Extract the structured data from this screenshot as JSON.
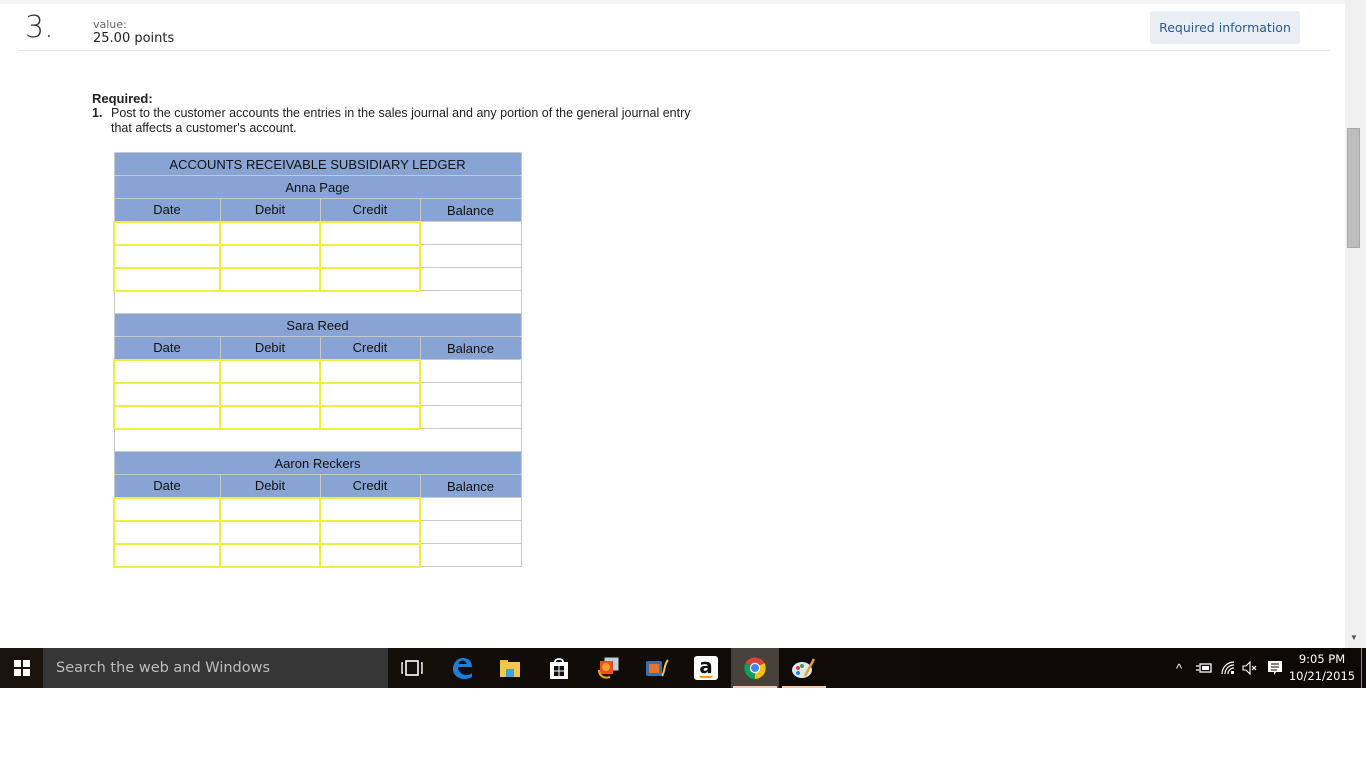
{
  "question": {
    "number": "3.",
    "value_label": "value:",
    "points": "25.00 points",
    "required_info_button": "Required information"
  },
  "instructions": {
    "title": "Required:",
    "items": [
      {
        "num": "1.",
        "text": "Post to the customer accounts the entries in the sales journal and any portion of the general journal entry that affects a customer's account."
      }
    ]
  },
  "ledger": {
    "title": "ACCOUNTS RECEIVABLE SUBSIDIARY LEDGER",
    "columns": [
      "Date",
      "Debit",
      "Credit",
      "Balance"
    ],
    "accounts": [
      {
        "name": "Anna Page",
        "rows": [
          [
            "",
            "",
            "",
            ""
          ],
          [
            "",
            "",
            "",
            ""
          ],
          [
            "",
            "",
            "",
            ""
          ]
        ]
      },
      {
        "name": "Sara Reed",
        "rows": [
          [
            "",
            "",
            "",
            ""
          ],
          [
            "",
            "",
            "",
            ""
          ],
          [
            "",
            "",
            "",
            ""
          ]
        ]
      },
      {
        "name": "Aaron Reckers",
        "rows": [
          [
            "",
            "",
            "",
            ""
          ],
          [
            "",
            "",
            "",
            ""
          ],
          [
            "",
            "",
            "",
            ""
          ]
        ]
      }
    ]
  },
  "taskbar": {
    "search_placeholder": "Search the web and Windows",
    "apps": [
      {
        "name": "task-view",
        "icon": "task-view-icon"
      },
      {
        "name": "edge",
        "icon": "edge-icon"
      },
      {
        "name": "file-explorer",
        "icon": "folder-icon"
      },
      {
        "name": "store",
        "icon": "store-icon"
      },
      {
        "name": "photo-gallery",
        "icon": "photo-gallery-icon"
      },
      {
        "name": "movie-maker",
        "icon": "movie-maker-icon"
      },
      {
        "name": "amazon",
        "icon": "amazon-icon",
        "glyph": "a"
      },
      {
        "name": "chrome",
        "icon": "chrome-icon",
        "active": true
      },
      {
        "name": "paint",
        "icon": "paint-icon",
        "running": true
      }
    ],
    "tray": {
      "time": "9:05 PM",
      "date": "10/21/2015"
    }
  },
  "colors": {
    "ledger_header": "#87a4d4",
    "input_border": "#f2ef3a",
    "button_bg": "#e9eef4",
    "button_text": "#2c5a8f",
    "taskbar_bg": "#120c08",
    "search_bg": "#363636"
  }
}
